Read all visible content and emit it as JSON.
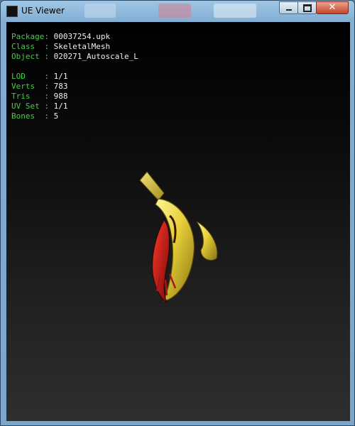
{
  "window": {
    "title": "UE Viewer",
    "controls": [
      "minimize",
      "maximize",
      "close"
    ]
  },
  "info": {
    "rows_group1": [
      {
        "key": "Package:",
        "value": "00037254.upk"
      },
      {
        "key": "Class  :",
        "value": "SkeletalMesh"
      },
      {
        "key": "Object :",
        "value": "020271_Autoscale_L"
      }
    ],
    "rows_group2": [
      {
        "key": "LOD    :",
        "value": "1/1"
      },
      {
        "key": "Verts  :",
        "value": "783"
      },
      {
        "key": "Tris   :",
        "value": "988"
      },
      {
        "key": "UV Set :",
        "value": "1/1"
      },
      {
        "key": "Bones  :",
        "value": "5"
      }
    ]
  },
  "colors": {
    "label_green": "#3fd13f",
    "value_white": "#f0f0f0",
    "banana_yellow": "#e8d84a",
    "accent_red": "#c81c1c"
  },
  "icons": {
    "app": "app-icon",
    "minimize": "minimize-icon",
    "maximize": "maximize-icon",
    "close": "close-icon"
  }
}
